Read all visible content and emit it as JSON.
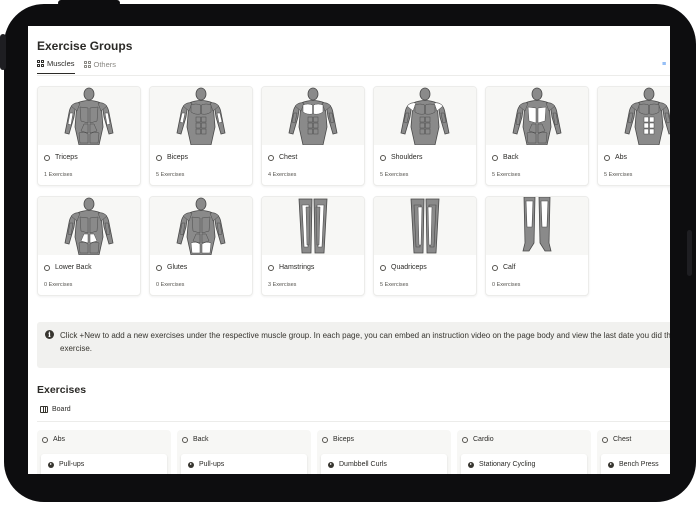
{
  "page": {
    "title": "Exercise Groups",
    "tabs": [
      {
        "label": "Muscles",
        "icon": "gallery-grid-icon",
        "active": true
      },
      {
        "label": "Others",
        "icon": "gallery-grid-icon",
        "active": false
      }
    ],
    "filter_icon": "filter-lines-icon",
    "accent_color": "#2f80ed"
  },
  "muscle_groups": [
    {
      "name": "Triceps",
      "count": "1 Exercises",
      "highlight": "triceps",
      "view": "back"
    },
    {
      "name": "Biceps",
      "count": "5 Exercises",
      "highlight": "biceps",
      "view": "front"
    },
    {
      "name": "Chest",
      "count": "4 Exercises",
      "highlight": "chest",
      "view": "front"
    },
    {
      "name": "Shoulders",
      "count": "5 Exercises",
      "highlight": "shoulders",
      "view": "front"
    },
    {
      "name": "Back",
      "count": "5 Exercises",
      "highlight": "back",
      "view": "back"
    },
    {
      "name": "Abs",
      "count": "5 Exercises",
      "highlight": "abs",
      "view": "front"
    },
    {
      "name": "Lower Back",
      "count": "0 Exercises",
      "highlight": "lowerback",
      "view": "back"
    },
    {
      "name": "Glutes",
      "count": "0 Exercises",
      "highlight": "glutes",
      "view": "back"
    },
    {
      "name": "Hamstrings",
      "count": "3 Exercises",
      "highlight": "hamstrings",
      "view": "legs"
    },
    {
      "name": "Quadriceps",
      "count": "5 Exercises",
      "highlight": "quads",
      "view": "legs"
    },
    {
      "name": "Calf",
      "count": "0 Exercises",
      "highlight": "calf",
      "view": "calves"
    }
  ],
  "callout": {
    "icon": "info-icon",
    "text": "Click +New to add a new exercises under the respective muscle group. In each page, you can embed an instruction video on the page body and view the last date you did the exercise."
  },
  "exercises": {
    "title": "Exercises",
    "view_label": "Board",
    "view_icon": "board-icon",
    "columns": [
      {
        "group": "Abs",
        "first_card": "Pull-ups"
      },
      {
        "group": "Back",
        "first_card": "Pull-ups"
      },
      {
        "group": "Biceps",
        "first_card": "Dumbbell Curls"
      },
      {
        "group": "Cardio",
        "first_card": "Stationary Cycling"
      },
      {
        "group": "Chest",
        "first_card": "Bench Press"
      }
    ]
  }
}
